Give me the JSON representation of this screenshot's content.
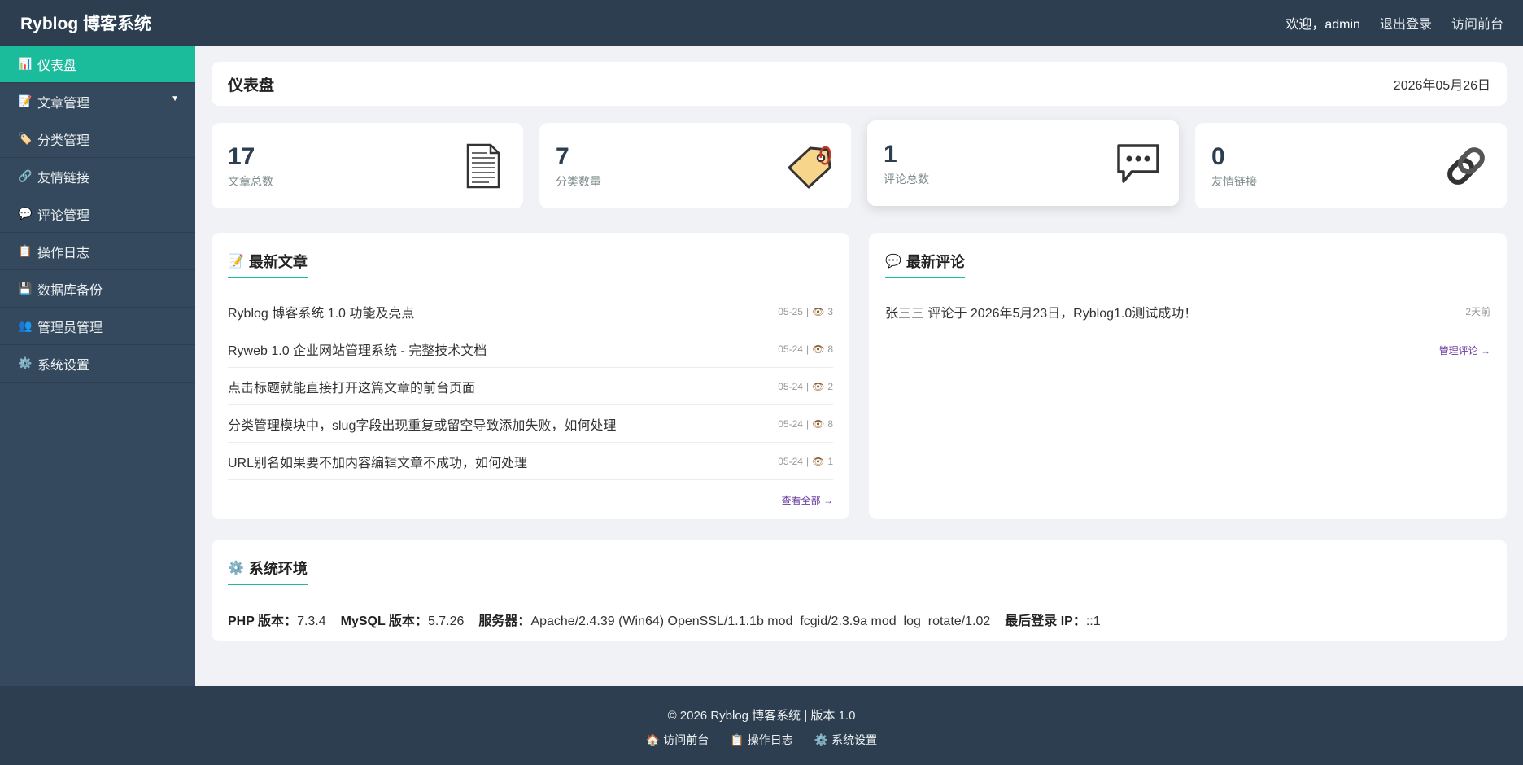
{
  "app": {
    "brand": "Ryblog 博客系统"
  },
  "topnav": {
    "welcome": "欢迎，admin",
    "logout": "退出登录",
    "visit": "访问前台"
  },
  "sidebar": {
    "items": [
      {
        "icon": "📊",
        "label": "仪表盘"
      },
      {
        "icon": "📝",
        "label": "文章管理"
      },
      {
        "icon": "🏷️",
        "label": "分类管理"
      },
      {
        "icon": "🔗",
        "label": "友情链接"
      },
      {
        "icon": "💬",
        "label": "评论管理"
      },
      {
        "icon": "📋",
        "label": "操作日志"
      },
      {
        "icon": "💾",
        "label": "数据库备份"
      },
      {
        "icon": "👥",
        "label": "管理员管理"
      },
      {
        "icon": "⚙️",
        "label": "系统设置"
      }
    ],
    "caret": "▼"
  },
  "header": {
    "title": "仪表盘",
    "date": "2026年05月26日"
  },
  "stats": [
    {
      "value": "17",
      "label": "文章总数",
      "icon": "document-icon"
    },
    {
      "value": "7",
      "label": "分类数量",
      "icon": "tag-icon"
    },
    {
      "value": "1",
      "label": "评论总数",
      "icon": "comment-icon"
    },
    {
      "value": "0",
      "label": "友情链接",
      "icon": "link-icon"
    }
  ],
  "latest_articles": {
    "icon": "📝",
    "title": "最新文章",
    "items": [
      {
        "title": "Ryblog 博客系统 1.0 功能及亮点",
        "date": "05-25",
        "views": "3"
      },
      {
        "title": "Ryweb 1.0 企业网站管理系统 - 完整技术文档",
        "date": "05-24",
        "views": "8"
      },
      {
        "title": "点击标题就能直接打开这篇文章的前台页面",
        "date": "05-24",
        "views": "2"
      },
      {
        "title": "分类管理模块中，slug字段出现重复或留空导致添加失败，如何处理",
        "date": "05-24",
        "views": "8"
      },
      {
        "title": "URL别名如果要不加内容编辑文章不成功，如何处理",
        "date": "05-24",
        "views": "1"
      }
    ],
    "more": "查看全部 →",
    "sep": "|",
    "eye": "👁"
  },
  "latest_comments": {
    "icon": "💬",
    "title": "最新评论",
    "items": [
      {
        "text": "张三三 评论于 2026年5月23日，Ryblog1.0测试成功！",
        "time": "2天前"
      }
    ],
    "more": "管理评论 →"
  },
  "env": {
    "icon": "⚙️",
    "title": "系统环境",
    "php_label": "PHP 版本：",
    "php": "7.3.4",
    "mysql_label": "MySQL 版本：",
    "mysql": "5.7.26",
    "server_label": "服务器：",
    "server": "Apache/2.4.39 (Win64) OpenSSL/1.1.1b mod_fcgid/2.3.9a mod_log_rotate/1.02",
    "ip_label": "最后登录 IP：",
    "ip": "::1"
  },
  "footer": {
    "copy": "© 2026 Ryblog 博客系统 | 版本 1.0",
    "links": [
      {
        "icon": "🏠",
        "label": "访问前台"
      },
      {
        "icon": "📋",
        "label": "操作日志"
      },
      {
        "icon": "⚙️",
        "label": "系统设置"
      }
    ]
  },
  "colors": {
    "accent": "#1abc9c",
    "topbar": "#2c3e50",
    "sidebar": "#34495e"
  }
}
